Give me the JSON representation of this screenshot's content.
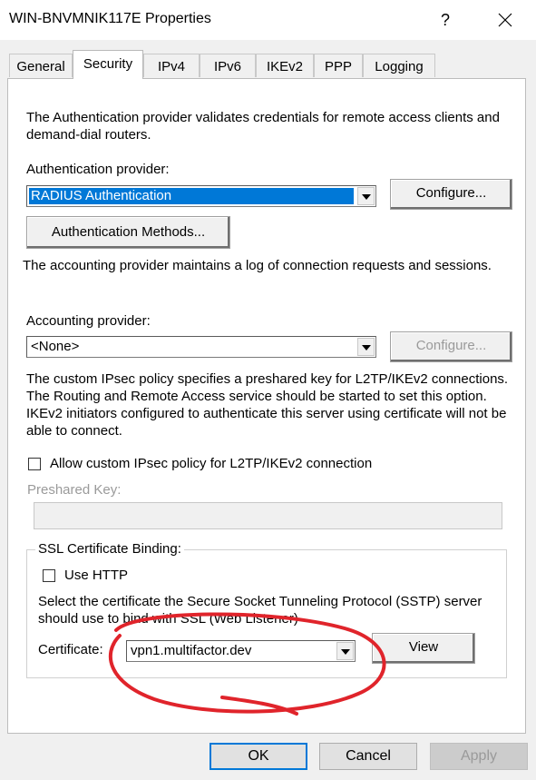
{
  "window": {
    "title": "WIN-BNVMNIK117E Properties",
    "help_label": "?"
  },
  "tabs": [
    {
      "label": "General"
    },
    {
      "label": "Security"
    },
    {
      "label": "IPv4"
    },
    {
      "label": "IPv6"
    },
    {
      "label": "IKEv2"
    },
    {
      "label": "PPP"
    },
    {
      "label": "Logging"
    }
  ],
  "auth": {
    "description": "The Authentication provider validates credentials for remote access clients and demand-dial routers.",
    "label": "Authentication provider:",
    "value": "RADIUS Authentication",
    "configure_label": "Configure...",
    "methods_label": "Authentication Methods..."
  },
  "accounting": {
    "description": "The accounting provider maintains a log of connection requests and sessions.",
    "label": "Accounting provider:",
    "value": "<None>",
    "configure_label": "Configure..."
  },
  "ipsec": {
    "description": "The custom IPsec policy specifies a preshared key for L2TP/IKEv2 connections. The Routing and Remote Access service should be started to set this option. IKEv2 initiators configured to authenticate this server using certificate will not be able to connect.",
    "checkbox_label": "Allow custom IPsec policy for L2TP/IKEv2 connection",
    "checked": false,
    "psk_label": "Preshared Key:",
    "psk_value": ""
  },
  "ssl": {
    "group_label": "SSL Certificate Binding:",
    "use_http_label": "Use HTTP",
    "use_http_checked": false,
    "description": "Select the certificate the Secure Socket Tunneling Protocol (SSTP) server should use to bind with SSL (Web Listener)",
    "certificate_label": "Certificate:",
    "certificate_value": "vpn1.multifactor.dev",
    "view_label": "View"
  },
  "footer": {
    "ok_label": "OK",
    "cancel_label": "Cancel",
    "apply_label": "Apply"
  },
  "colors": {
    "accent": "#0078d7",
    "annotation": "#e0242b"
  }
}
